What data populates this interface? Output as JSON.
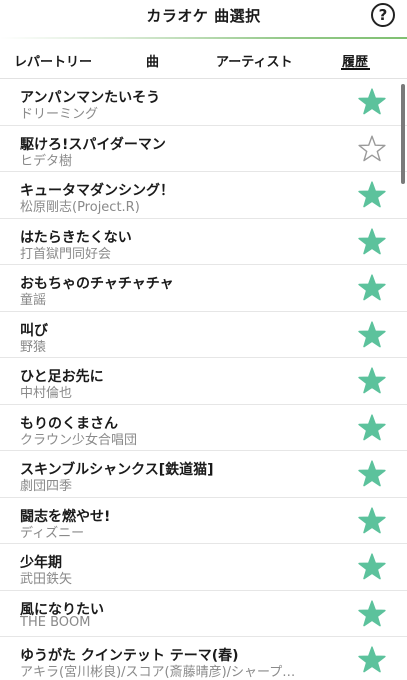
{
  "header": {
    "title": "カラオケ 曲選択",
    "help_icon_label": "?"
  },
  "tabs": [
    {
      "label": "レパートリー",
      "active": false
    },
    {
      "label": "曲",
      "active": false
    },
    {
      "label": "アーティスト",
      "active": false
    },
    {
      "label": "履歴",
      "active": true
    }
  ],
  "colors": {
    "star_filled": "#5cc29c",
    "star_outline": "#9a9a9a",
    "accent_line": "#7fc071"
  },
  "songs": [
    {
      "title": "アンパンマンたいそう",
      "artist": "ドリーミング",
      "favorite": true
    },
    {
      "title": "駆けろ!スパイダーマン",
      "artist": "ヒデタ樹",
      "favorite": false
    },
    {
      "title": "キュータマダンシング！",
      "artist": "松原剛志(Project.R)",
      "favorite": true
    },
    {
      "title": "はたらきたくない",
      "artist": "打首獄門同好会",
      "favorite": true
    },
    {
      "title": "おもちゃのチャチャチャ",
      "artist": "童謡",
      "favorite": true
    },
    {
      "title": "叫び",
      "artist": "野猿",
      "favorite": true
    },
    {
      "title": "ひと足お先に",
      "artist": "中村倫也",
      "favorite": true
    },
    {
      "title": "もりのくまさん",
      "artist": "クラウン少女合唱団",
      "favorite": true
    },
    {
      "title": "スキンブルシャンクス[鉄道猫]",
      "artist": "劇団四季",
      "favorite": true
    },
    {
      "title": "闘志を燃やせ!",
      "artist": "ディズニー",
      "favorite": true
    },
    {
      "title": "少年期",
      "artist": "武田鉄矢",
      "favorite": true
    },
    {
      "title": "風になりたい",
      "artist": "THE BOOM",
      "favorite": true
    },
    {
      "title": "ゆうがた クインテット テーマ(春)",
      "artist": "アキラ(宮川彬良)/スコア(斎藤晴彦)/シャープ…",
      "favorite": true
    }
  ]
}
